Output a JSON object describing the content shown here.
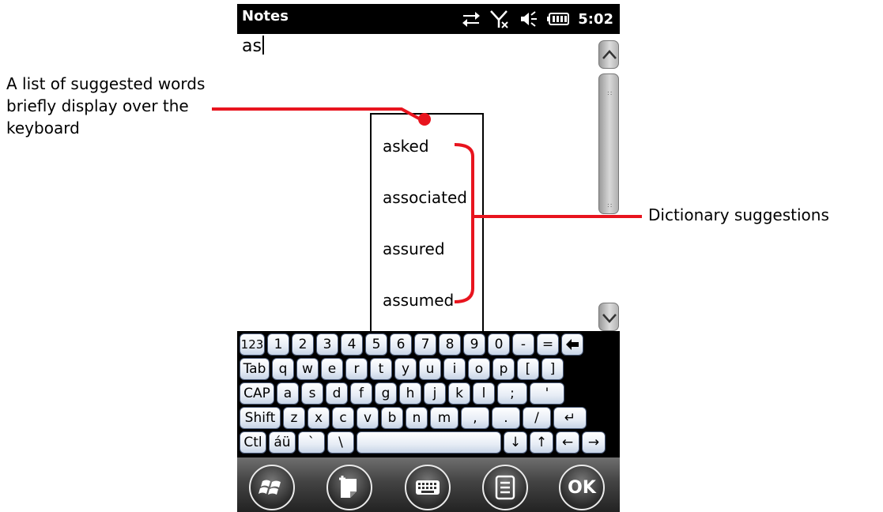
{
  "app": {
    "title": "Notes",
    "clock": "5:02"
  },
  "note": {
    "text": "as"
  },
  "suggestions": [
    "asked",
    "associated",
    "assured",
    "assumed"
  ],
  "keyboard": {
    "rows": [
      [
        "123",
        "1",
        "2",
        "3",
        "4",
        "5",
        "6",
        "7",
        "8",
        "9",
        "0",
        "-",
        "=",
        "←back"
      ],
      [
        "Tab",
        "q",
        "w",
        "e",
        "r",
        "t",
        "y",
        "u",
        "i",
        "o",
        "p",
        "[",
        "]"
      ],
      [
        "CAP",
        "a",
        "s",
        "d",
        "f",
        "g",
        "h",
        "j",
        "k",
        "l",
        ";",
        "'"
      ],
      [
        "Shift",
        "z",
        "x",
        "c",
        "v",
        "b",
        "n",
        "m",
        ",",
        ".",
        "/",
        "↵"
      ],
      [
        "Ctl",
        "áü",
        "`",
        "\\",
        " ",
        "↓",
        "↑",
        "←",
        "→"
      ]
    ]
  },
  "softkeys": {
    "ok_label": "OK"
  },
  "annotations": {
    "left_text": "A list of suggested words briefly display over the keyboard",
    "right_text": "Dictionary suggestions",
    "color": "#e8141e"
  },
  "icons": [
    "data-connection-icon",
    "no-signal-icon",
    "speaker-icon",
    "battery-icon",
    "windows-start-icon",
    "new-note-icon",
    "keyboard-icon",
    "menu-icon"
  ]
}
